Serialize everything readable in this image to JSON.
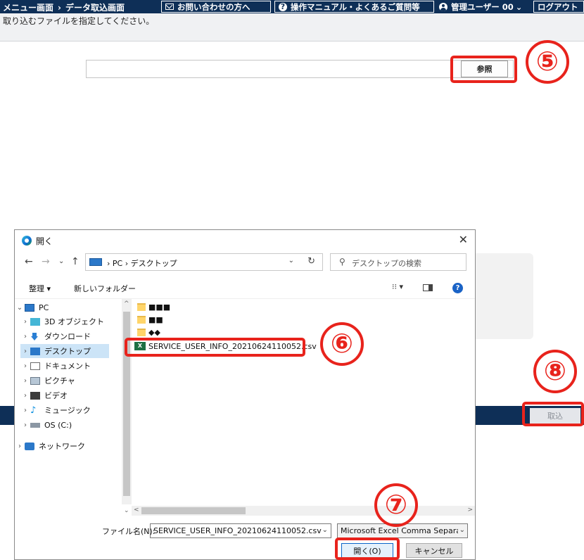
{
  "header": {
    "crumb_menu": "メニュー画面",
    "crumb_sep": "›",
    "crumb_current": "データ取込画面",
    "contact_label": "お問い合わせの方へ",
    "manual_label": "操作マニュアル・よくあるご質問等",
    "user_label": "管理ユーザー 00",
    "user_caret": "⌄",
    "logout_label": "ログアウト"
  },
  "instruction": "取り込むファイルを指定してください。",
  "browse_label": "参照",
  "import_label": "取込",
  "annotations": {
    "step5": "⑤",
    "step6": "⑥",
    "step7": "⑦",
    "step8": "⑧"
  },
  "colors": {
    "nav_bg": "#0e2f57",
    "highlight": "#e8231c"
  },
  "dialog": {
    "title": "開く",
    "close": "✕",
    "back": "←",
    "forward": "→",
    "recent": "⌄",
    "up": "↑",
    "address_path": "› PC › デスクトップ",
    "address_dropdown": "⌄",
    "refresh": "↻",
    "search_icon": "⚲",
    "search_placeholder": "デスクトップの検索",
    "organize": "整理 ▾",
    "new_folder": "新しいフォルダー",
    "view_label": "⁝⁝ ▾",
    "help": "?",
    "nav_items": [
      {
        "chev": "⌄",
        "label": "PC",
        "icon": "pc-icon"
      },
      {
        "chev": "›",
        "label": "3D オブジェクト",
        "icon": "cube-icon"
      },
      {
        "chev": "›",
        "label": "ダウンロード",
        "icon": "download-icon"
      },
      {
        "chev": "›",
        "label": "デスクトップ",
        "icon": "desktop-icon"
      },
      {
        "chev": "›",
        "label": "ドキュメント",
        "icon": "document-icon"
      },
      {
        "chev": "›",
        "label": "ピクチャ",
        "icon": "picture-icon"
      },
      {
        "chev": "›",
        "label": "ビデオ",
        "icon": "video-icon"
      },
      {
        "chev": "›",
        "label": "ミュージック",
        "icon": "music-icon"
      },
      {
        "chev": "›",
        "label": "OS (C:)",
        "icon": "drive-icon"
      },
      {
        "chev": "›",
        "label": "ネットワーク",
        "icon": "network-icon"
      }
    ],
    "files": [
      {
        "name": "■■■",
        "type": "folder"
      },
      {
        "name": "■■",
        "type": "folder"
      },
      {
        "name": "◆◆",
        "type": "folder"
      },
      {
        "name": "SERVICE_USER_INFO_20210624110052.csv",
        "type": "csv"
      }
    ],
    "filename_label": "ファイル名(N):",
    "filename_value": "SERVICE_USER_INFO_20210624110052.csv",
    "filename_dropdown": "⌄",
    "filetype_value": "Microsoft Excel Comma Separat",
    "filetype_dropdown": "⌄",
    "open_label": "開く(O)",
    "cancel_label": "キャンセル",
    "scroll_up": "^",
    "scroll_down": "⌄",
    "scroll_left": "<",
    "scroll_right": ">"
  }
}
